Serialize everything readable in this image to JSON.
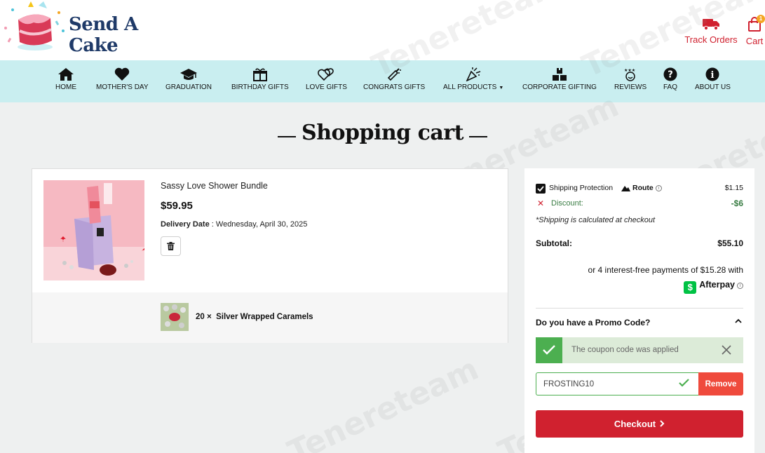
{
  "brand": {
    "name": "Send A Cake"
  },
  "header": {
    "track_orders_label": "Track Orders",
    "cart_label": "Cart",
    "cart_count": "1"
  },
  "nav": {
    "items": [
      {
        "label": "HOME",
        "icon": "home-icon"
      },
      {
        "label": "MOTHER'S DAY",
        "icon": "heart-icon"
      },
      {
        "label": "GRADUATION",
        "icon": "graduation-cap-icon"
      },
      {
        "label": "BIRTHDAY GIFTS",
        "icon": "gift-icon"
      },
      {
        "label": "LOVE GIFTS",
        "icon": "hearts-icon"
      },
      {
        "label": "CONGRATS GIFTS",
        "icon": "champagne-icon"
      },
      {
        "label": "ALL PRODUCTS",
        "icon": "party-popper-icon",
        "has_dropdown": true
      },
      {
        "label": "CORPORATE GIFTING",
        "icon": "boxes-icon"
      },
      {
        "label": "REVIEWS",
        "icon": "stars-face-icon"
      },
      {
        "label": "FAQ",
        "icon": "question-icon"
      },
      {
        "label": "ABOUT US",
        "icon": "info-icon"
      }
    ]
  },
  "page": {
    "title": "Shopping cart",
    "watermark": "Tenereteam"
  },
  "cart_item": {
    "name": "Sassy Love Shower Bundle",
    "price": "$59.95",
    "delivery_label": "Delivery Date",
    "delivery_date": " : Wednesday, April 30, 2025",
    "addon": {
      "quantity": "20 ×",
      "name": "Silver Wrapped Caramels"
    }
  },
  "summary": {
    "shipping_protection_label": "Shipping Protection",
    "route_label": "Route",
    "shipping_protection_price": "$1.15",
    "discount_label": "Discount:",
    "discount_value": "-$6",
    "shipping_note": "*Shipping is calculated at checkout",
    "subtotal_label": "Subtotal:",
    "subtotal_value": "$55.10",
    "afterpay_text": "or 4 interest-free payments of $15.28 with",
    "afterpay_label": "Afterpay",
    "promo_question": "Do you have a Promo Code?",
    "coupon_success": "The coupon code was applied",
    "promo_code_value": "FROSTING10",
    "remove_label": "Remove",
    "checkout_label": "Checkout"
  },
  "colors": {
    "nav_bg": "#c9eef0",
    "brand_red": "#d0212f",
    "success_green": "#4caf50",
    "remove_red": "#ef4a3c",
    "logo_navy": "#1f3a68"
  }
}
